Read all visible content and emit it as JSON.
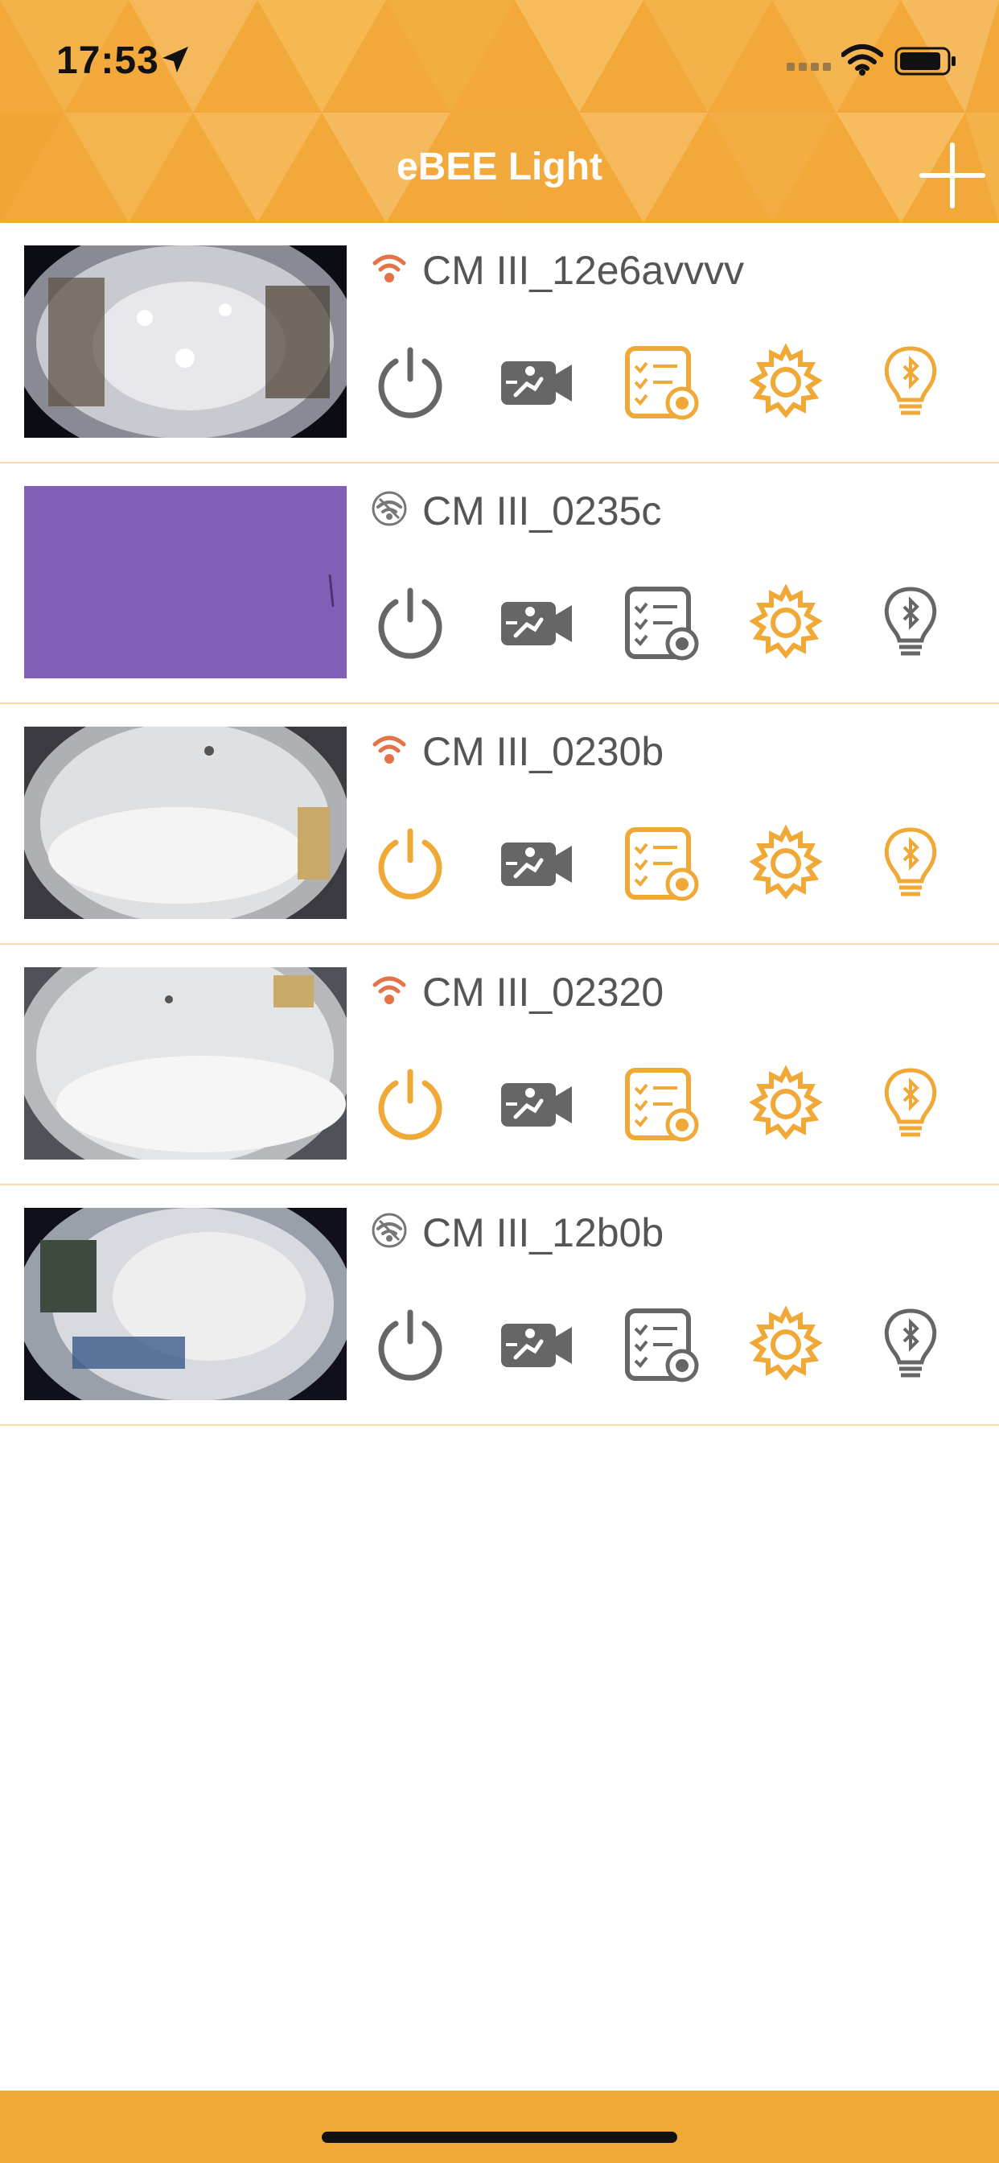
{
  "status_bar": {
    "time": "17:53"
  },
  "header": {
    "title": "eBEE Light"
  },
  "colors": {
    "accent": "#f0a837",
    "inactive": "#666666",
    "wifi_on": "#e5734a"
  },
  "cameras": [
    {
      "name": "CM III_12e6avvvv",
      "connected": true,
      "power_on": false,
      "bluetooth_on": true,
      "schedule_on": true
    },
    {
      "name": "CM III_0235c",
      "connected": false,
      "power_on": false,
      "bluetooth_on": false,
      "schedule_on": false
    },
    {
      "name": "CM III_0230b",
      "connected": true,
      "power_on": true,
      "bluetooth_on": true,
      "schedule_on": true
    },
    {
      "name": "CM III_02320",
      "connected": true,
      "power_on": true,
      "bluetooth_on": true,
      "schedule_on": true
    },
    {
      "name": "CM III_12b0b",
      "connected": false,
      "power_on": false,
      "bluetooth_on": false,
      "schedule_on": false
    }
  ]
}
